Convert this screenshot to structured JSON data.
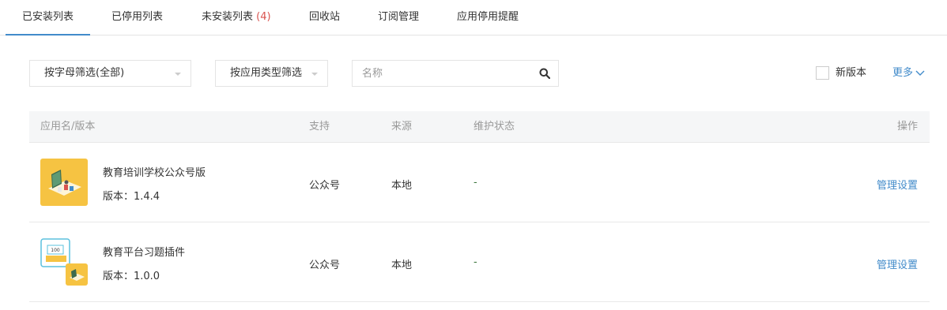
{
  "tabs": [
    {
      "label": "已安装列表"
    },
    {
      "label": "已停用列表"
    },
    {
      "label": "未安装列表",
      "count": "(4)"
    },
    {
      "label": "回收站"
    },
    {
      "label": "订阅管理"
    },
    {
      "label": "应用停用提醒"
    }
  ],
  "active_tab": "已安装列表",
  "filters": {
    "letter": "按字母筛选(全部)",
    "type": "按应用类型筛选"
  },
  "search": {
    "placeholder": "名称",
    "value": "",
    "icon": "search-icon"
  },
  "new_version": {
    "label": "新版本",
    "checked": false
  },
  "more": {
    "label": "更多",
    "icon": "chevron-down-icon"
  },
  "table": {
    "headers": {
      "name": "应用名/版本",
      "support": "支持",
      "source": "来源",
      "status": "维护状态",
      "op": "操作"
    },
    "rows": [
      {
        "name": "教育培训学校公众号版",
        "version": "版本：1.4.4",
        "support": "公众号",
        "source": "本地",
        "status": "-",
        "op": "管理设置",
        "icon": "education-app-icon"
      },
      {
        "name": "教育平台习题插件",
        "version": "版本：1.0.0",
        "support": "公众号",
        "source": "本地",
        "status": "-",
        "op": "管理设置",
        "icon": "exercise-plugin-icon"
      }
    ]
  },
  "colors": {
    "accent": "#428bca",
    "count": "#d9534f",
    "status": "#3c763d",
    "icon_yellow": "#f6c342"
  }
}
